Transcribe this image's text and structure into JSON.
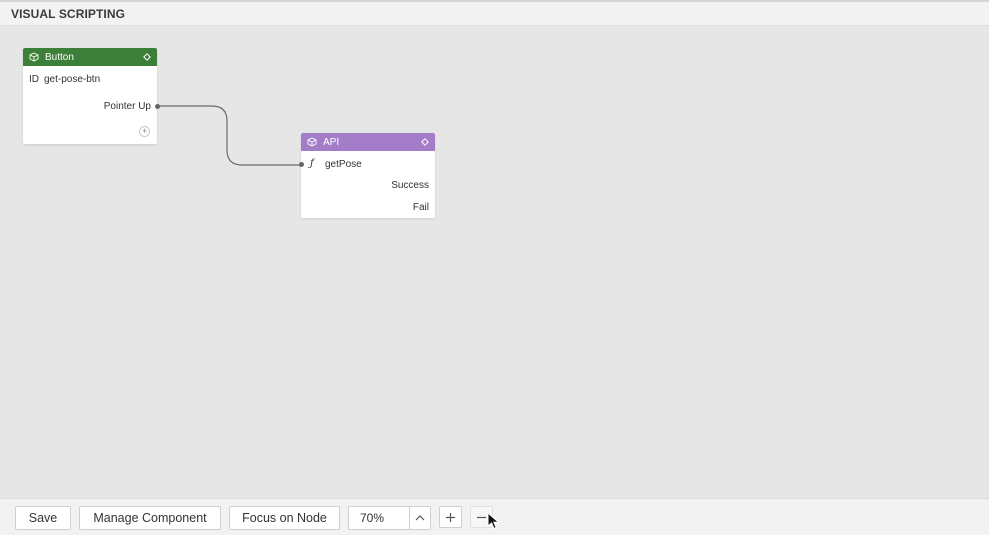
{
  "header": {
    "title": "VISUAL SCRIPTING"
  },
  "nodes": {
    "button": {
      "title": "Button",
      "color": "#3c7f38",
      "id_label": "ID",
      "id_value": "get-pose-btn",
      "output_label": "Pointer Up",
      "add_port": "+"
    },
    "api": {
      "title": "API",
      "color": "#a37dc8",
      "function_icon": "ƒ",
      "function_name": "getPose",
      "outputs": [
        "Success",
        "Fail"
      ]
    }
  },
  "toolbar": {
    "save_label": "Save",
    "manage_label": "Manage Component",
    "focus_label": "Focus on Node",
    "zoom_value": "70%",
    "zoom_in_icon": "plus-icon",
    "zoom_out_icon": "minus-icon"
  }
}
